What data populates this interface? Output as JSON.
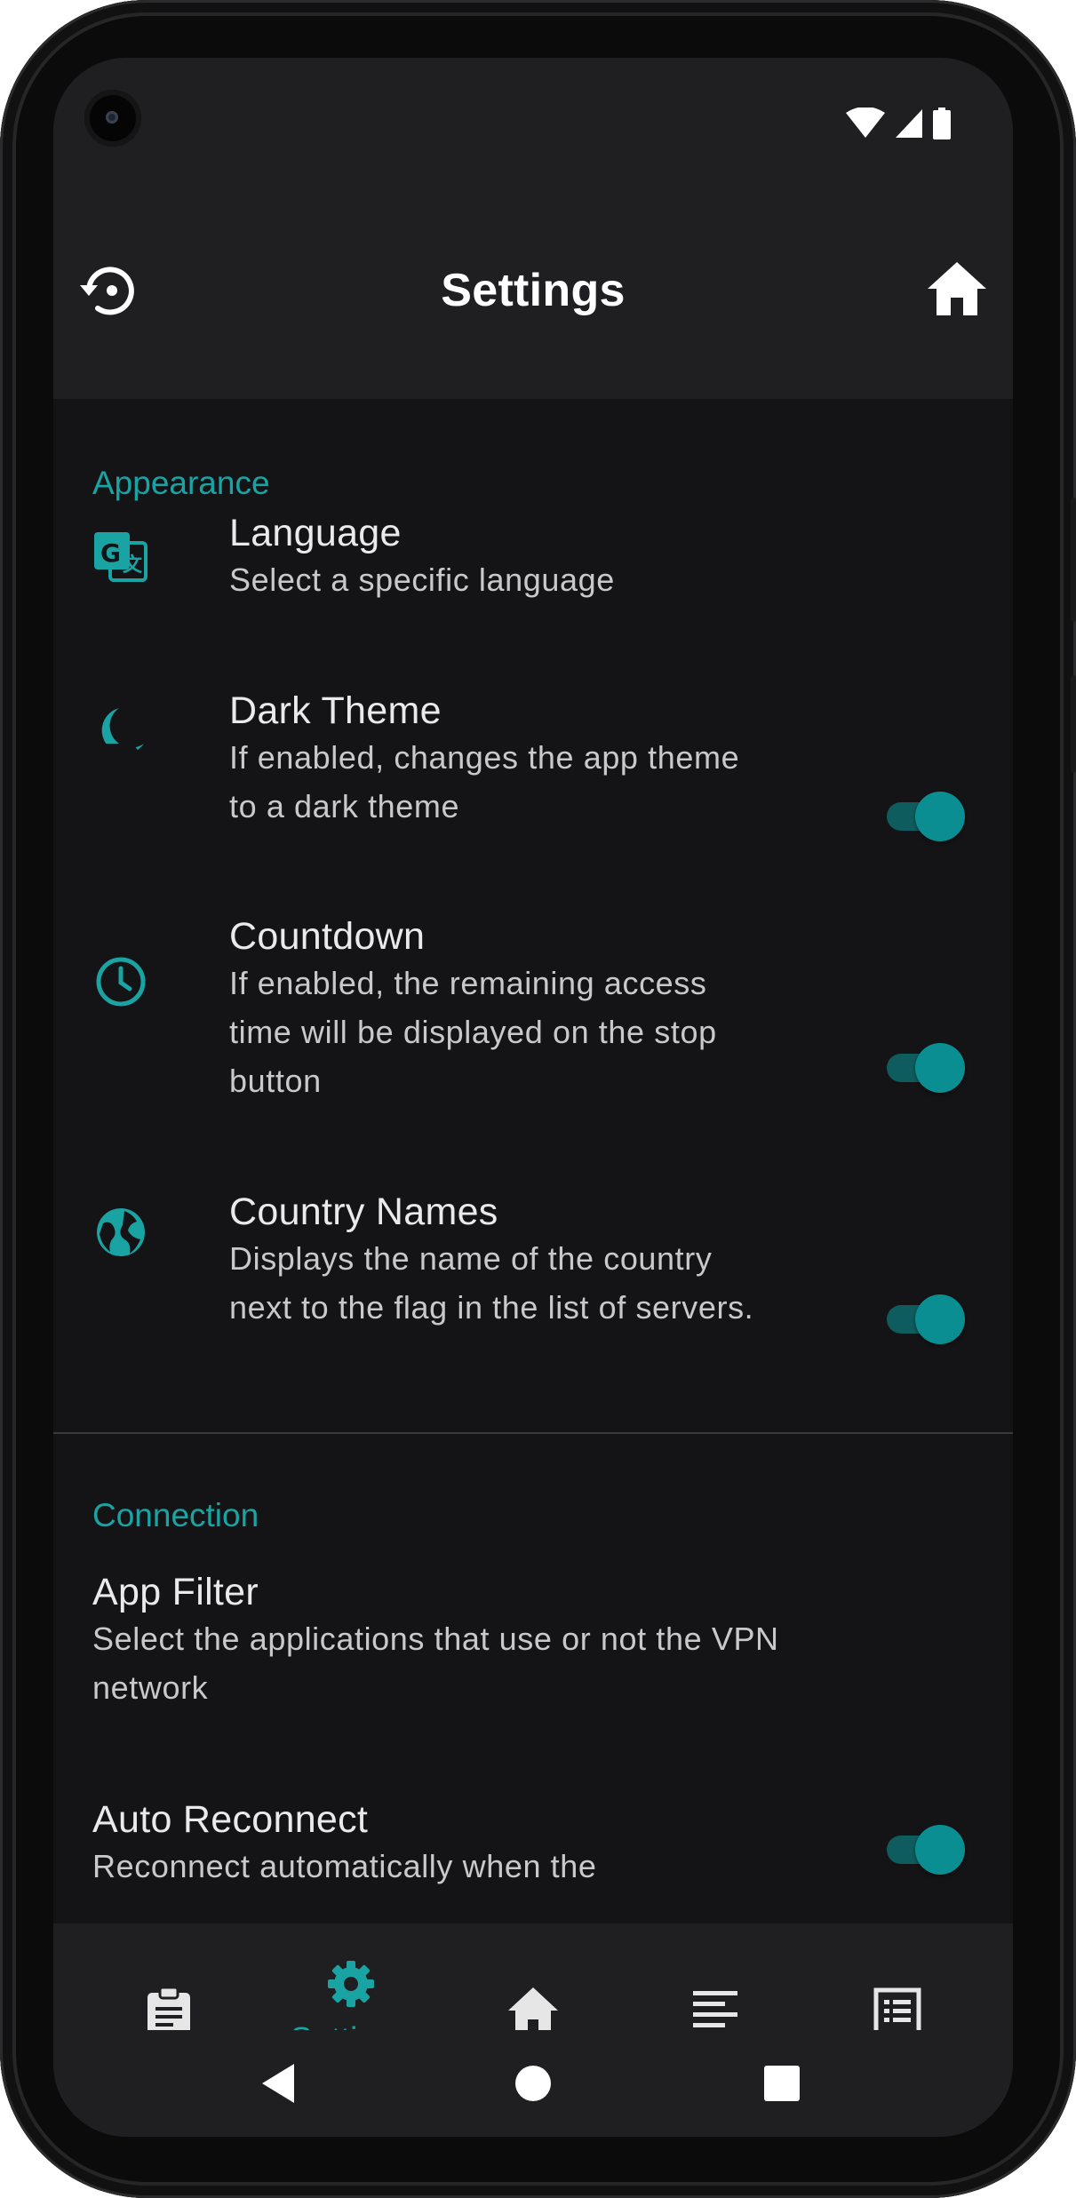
{
  "colors": {
    "accent": "#1aa3a3",
    "background": "#141416",
    "bar": "#1f1f21",
    "text_primary": "#eaeaea",
    "text_secondary": "#c9c9c9"
  },
  "status_bar": {
    "icons": [
      "wifi-icon",
      "cell-signal-icon",
      "battery-icon"
    ]
  },
  "app_bar": {
    "title": "Settings",
    "left_icon": "restore-icon",
    "right_icon": "home-icon"
  },
  "sections": {
    "appearance": {
      "title": "Appearance",
      "items": [
        {
          "icon": "translate-icon",
          "title": "Language",
          "subtitle_lines": [
            "Select a specific language"
          ]
        },
        {
          "icon": "dark-theme-icon",
          "title": "Dark Theme",
          "subtitle_lines": [
            "If enabled, changes the app theme",
            "to a dark theme"
          ],
          "toggle_on": true
        },
        {
          "icon": "clock-icon",
          "title": "Countdown",
          "subtitle_lines": [
            "If enabled, the remaining access",
            "time will be displayed on the stop",
            "button"
          ],
          "toggle_on": true
        },
        {
          "icon": "globe-icon",
          "title": "Country Names",
          "subtitle_lines": [
            "Displays the name of the country",
            "next to the flag in the list of servers."
          ],
          "toggle_on": true
        }
      ]
    },
    "connection": {
      "title": "Connection",
      "items": [
        {
          "title": "App Filter",
          "subtitle_lines": [
            "Select the applications that use or not the VPN",
            "network"
          ]
        },
        {
          "title": "Auto Reconnect",
          "subtitle_lines": [
            "Reconnect automatically when the"
          ],
          "toggle_on": true
        }
      ]
    }
  },
  "bottom_nav": {
    "items": [
      {
        "icon": "clipboard-icon",
        "label": ""
      },
      {
        "icon": "gear-icon",
        "label": "Settings",
        "active": true
      },
      {
        "icon": "home-icon",
        "label": ""
      },
      {
        "icon": "text-lines-icon",
        "label": ""
      },
      {
        "icon": "list-box-icon",
        "label": ""
      }
    ]
  },
  "system_nav": {
    "icons": [
      "back-icon",
      "home-circle-icon",
      "recents-icon"
    ]
  }
}
